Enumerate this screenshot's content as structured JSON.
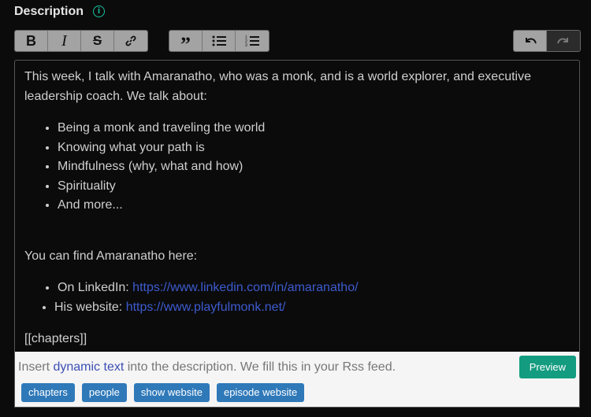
{
  "header": {
    "title": "Description",
    "info_icon": "info-circle-icon"
  },
  "toolbar": {
    "format": [
      "bold",
      "italic",
      "strikethrough",
      "link"
    ],
    "blocks": [
      "blockquote",
      "bullet-list",
      "numbered-list"
    ],
    "history": [
      "undo",
      "redo"
    ]
  },
  "editor": {
    "intro": " This week, I talk with Amaranatho, who was a monk, and is a world explorer, and executive leadership coach. We talk about:",
    "topics": [
      "Being a monk and traveling the world",
      "Knowing what your path is",
      "Mindfulness (why, what and how)",
      "Spirituality",
      "And more..."
    ],
    "find": " You can find Amaranatho here:",
    "links": [
      {
        "label": "On LinkedIn: ",
        "url": "https://www.linkedin.com/in/amaranatho/"
      },
      {
        "label": "His website: ",
        "url": "https://www.playfulmonk.net/"
      }
    ],
    "chapters": "[[chapters]]"
  },
  "panel": {
    "hint_pre": "Insert ",
    "hint_link": "dynamic text",
    "hint_post": " into the description. We fill this in your Rss feed.",
    "preview": "Preview",
    "tags": [
      "chapters",
      "people",
      "show website",
      "episode website"
    ]
  },
  "colors": {
    "accent": "#149c80",
    "tag": "#2f79b9",
    "link": "#3d5bd0"
  }
}
